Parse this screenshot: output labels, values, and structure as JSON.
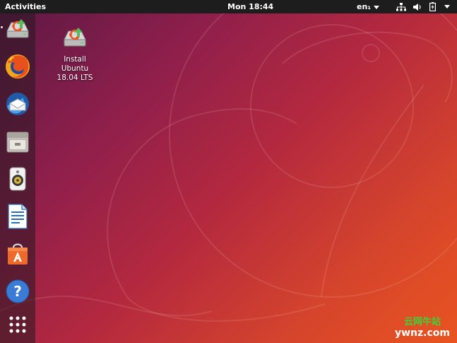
{
  "topbar": {
    "activities_label": "Activities",
    "clock": "Mon 18:44",
    "input_language": "en₁",
    "tray_icons": [
      "network-wired-icon",
      "volume-icon",
      "battery-icon",
      "system-menu-caret-icon"
    ]
  },
  "dock": {
    "items": [
      {
        "name": "Install Ubuntu 18.04 LTS",
        "icon": "ubiquity-installer-icon"
      },
      {
        "name": "Firefox Web Browser",
        "icon": "firefox-icon"
      },
      {
        "name": "Thunderbird Mail",
        "icon": "thunderbird-icon"
      },
      {
        "name": "Files",
        "icon": "files-icon"
      },
      {
        "name": "Rhythmbox",
        "icon": "rhythmbox-icon"
      },
      {
        "name": "LibreOffice Writer",
        "icon": "writer-icon"
      },
      {
        "name": "Ubuntu Software",
        "icon": "software-center-icon"
      },
      {
        "name": "Help",
        "icon": "help-icon"
      }
    ],
    "show_applications_icon": "app-grid-icon"
  },
  "desktop": {
    "icons": [
      {
        "label_lines": [
          "Install",
          "Ubuntu",
          "18.04 LTS"
        ],
        "icon": "ubiquity-installer-icon"
      }
    ]
  },
  "watermark": {
    "line1": "云网牛站",
    "line2": "ywnz.com"
  },
  "colors": {
    "topbar": "#1d1d1d",
    "wallpaper_dark": "#5b1845",
    "wallpaper_orange": "#e95420",
    "watermark_green": "#3dd23a"
  }
}
